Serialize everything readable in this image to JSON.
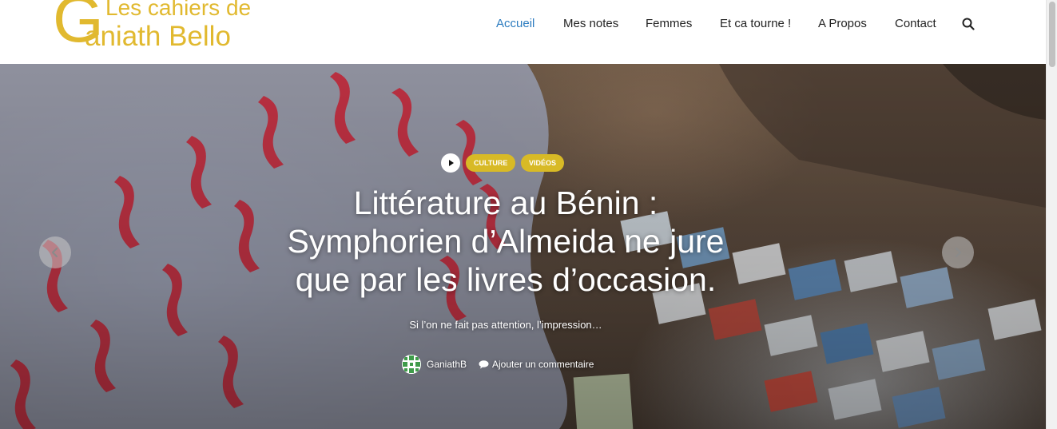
{
  "site": {
    "logo_initial": "G",
    "logo_line1": "Les cahiers de",
    "logo_line2": "aniath Bello",
    "brand_color": "#e1b92f"
  },
  "nav": {
    "items": [
      {
        "label": "Accueil",
        "active": true
      },
      {
        "label": "Mes notes"
      },
      {
        "label": "Femmes"
      },
      {
        "label": "Et ca tourne !"
      },
      {
        "label": "A Propos"
      },
      {
        "label": "Contact"
      }
    ],
    "search_icon": "search-icon",
    "active_color": "#2a7bbf"
  },
  "hero": {
    "media_icon": "play-icon",
    "tags": [
      "Culture",
      "Vidéos"
    ],
    "tag_color": "#d8ba26",
    "title_lines": [
      "Littérature au Bénin :",
      "Symphorien d’Almeida ne jure",
      "que par les livres d’occasion."
    ],
    "excerpt": "Si l’on ne fait pas attention, l’impression…",
    "author": "GaniathB",
    "comment_link": "Ajouter un commentaire",
    "comment_icon": "comment-icon",
    "prev_icon": "chevron-left-icon",
    "next_icon": "chevron-right-icon"
  }
}
